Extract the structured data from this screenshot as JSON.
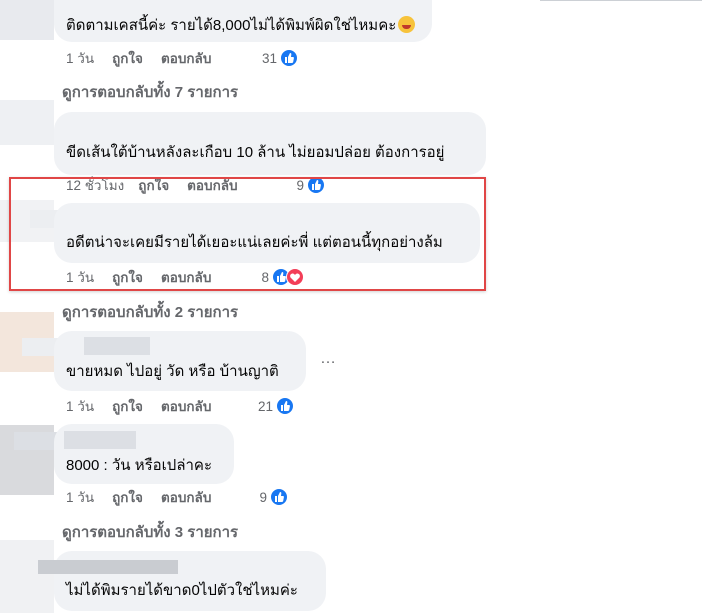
{
  "comments": [
    {
      "text": "ติดตามเคสนี้ค่ะ รายได้8,000ไม่ได้พิมพ์ผิดใช่ไหมคะ",
      "emoji": "laugh-cry-emoji",
      "time": "1 วัน",
      "like": "ถูกใจ",
      "reply": "ตอบกลับ",
      "reactions": "31"
    },
    {
      "text": "ขีดเส้นใต้บ้านหลังละเกือบ 10 ล้าน ไม่ยอมปล่อย ต้องการอยู่",
      "time": "12 ชั่วโมง",
      "like": "ถูกใจ",
      "reply": "ตอบกลับ",
      "reactions": "9"
    },
    {
      "text": "อดีตน่าจะเคยมีรายได้เยอะแน่เลยค่ะพี่ แต่ตอนนี้ทุกอย่างล้ม",
      "time": "1 วัน",
      "like": "ถูกใจ",
      "reply": "ตอบกลับ",
      "reactions": "8"
    },
    {
      "text": "ขายหมด ไปอยู่ วัด หรือ บ้านญาติ",
      "time": "1 วัน",
      "like": "ถูกใจ",
      "reply": "ตอบกลับ",
      "reactions": "21"
    },
    {
      "text": "8000 : วัน หรือเปล่าคะ",
      "time": "1 วัน",
      "like": "ถูกใจ",
      "reply": "ตอบกลับ",
      "reactions": "9"
    },
    {
      "text": "ไม่ได้พิมรายได้ขาด0ไปตัวใช่ไหมค่ะ"
    }
  ],
  "view_replies": [
    "ดูการตอบกลับทั้ง 7 รายการ",
    "ดูการตอบกลับทั้ง 2 รายการ",
    "ดูการตอบกลับทั้ง 3 รายการ"
  ],
  "more_options": "…",
  "colors": {
    "highlight_border": "#e04646",
    "like_blue": "#1877f2",
    "love_red": "#f33e58",
    "bubble_bg": "#f0f2f5",
    "meta_gray": "#65676b"
  }
}
